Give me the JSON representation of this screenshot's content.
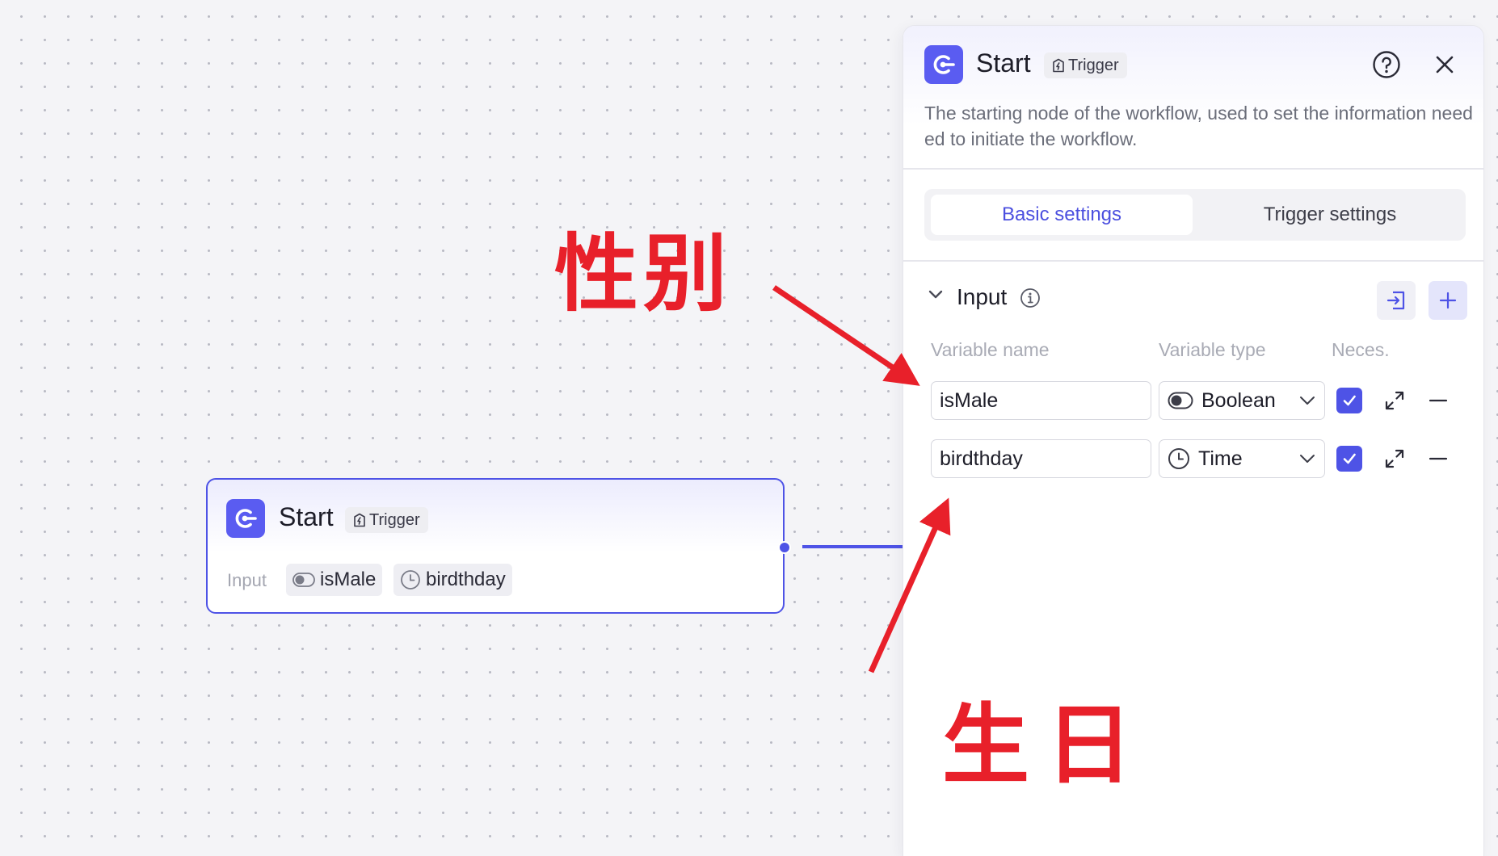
{
  "colors": {
    "accent": "#4e53e6",
    "annotation": "#e8202a"
  },
  "canvas_node": {
    "title": "Start",
    "badge": "Trigger",
    "input_label": "Input",
    "chips": [
      {
        "icon": "toggle-icon",
        "label": "isMale"
      },
      {
        "icon": "clock-icon",
        "label": "birdthday"
      }
    ]
  },
  "panel": {
    "title": "Start",
    "badge": "Trigger",
    "description": "The starting node of the workflow, used to set the information needed to initiate the workflow.",
    "tabs": [
      {
        "label": "Basic settings",
        "active": true
      },
      {
        "label": "Trigger settings",
        "active": false
      }
    ],
    "section": {
      "title": "Input",
      "columns": [
        "Variable name",
        "Variable type",
        "Neces."
      ],
      "rows": [
        {
          "name": "isMale",
          "type": "Boolean",
          "type_icon": "toggle-icon",
          "required": true
        },
        {
          "name": "birdthday",
          "type": "Time",
          "type_icon": "clock-icon",
          "required": true
        }
      ]
    }
  },
  "annotations": [
    {
      "text": "性别",
      "target": "isMale"
    },
    {
      "text": "生日",
      "target": "birdthday"
    }
  ]
}
